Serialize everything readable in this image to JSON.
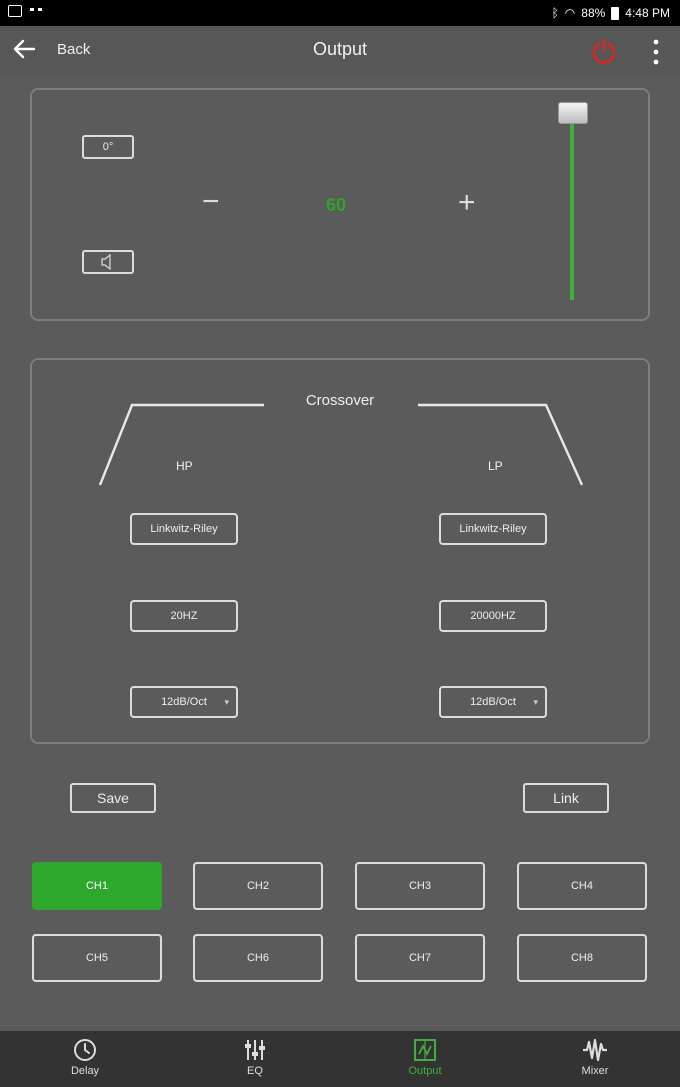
{
  "status_bar": {
    "battery": "88%",
    "time": "4:48 PM"
  },
  "header": {
    "back_label": "Back",
    "title": "Output"
  },
  "volume": {
    "phase": "0°",
    "minus": "−",
    "value": "60",
    "plus": "+"
  },
  "crossover": {
    "title": "Crossover",
    "hp": {
      "label": "HP",
      "filter": "Linkwitz-Riley",
      "frequency": "20HZ",
      "slope": "12dB/Oct"
    },
    "lp": {
      "label": "LP",
      "filter": "Linkwitz-Riley",
      "frequency": "20000HZ",
      "slope": "12dB/Oct"
    }
  },
  "actions": {
    "save": "Save",
    "link": "Link"
  },
  "channels": [
    {
      "label": "CH1",
      "active": true
    },
    {
      "label": "CH2",
      "active": false
    },
    {
      "label": "CH3",
      "active": false
    },
    {
      "label": "CH4",
      "active": false
    },
    {
      "label": "CH5",
      "active": false
    },
    {
      "label": "CH6",
      "active": false
    },
    {
      "label": "CH7",
      "active": false
    },
    {
      "label": "CH8",
      "active": false
    }
  ],
  "nav": [
    {
      "label": "Delay",
      "icon": "clock-icon"
    },
    {
      "label": "EQ",
      "icon": "equalizer-icon"
    },
    {
      "label": "Output",
      "icon": "output-icon",
      "active": true
    },
    {
      "label": "Mixer",
      "icon": "mixer-icon"
    }
  ],
  "colors": {
    "accent": "#2da82d",
    "power": "#e02424",
    "background": "#5b5b5b"
  }
}
